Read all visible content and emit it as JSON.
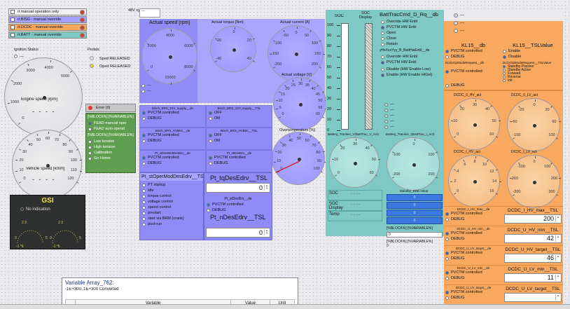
{
  "override": {
    "items": [
      {
        "label": "rt manual operation only",
        "color": "#f2f2f2"
      },
      {
        "label": "rt.BISG - manual override",
        "color": "#a6a0ff"
      },
      {
        "label": "rt.DCDC - manual override",
        "color": "#f8a85f"
      },
      {
        "label": "rt.BATT - manual override",
        "color": "#7fc9c4"
      }
    ]
  },
  "system_status_label": "48V system status",
  "system_status_value": "---",
  "ignition": {
    "title": "Ignition Status",
    "value": "---"
  },
  "pedals": {
    "title": "Pedals",
    "items": [
      "Sped RELEASED",
      "Oped RELEASED"
    ]
  },
  "engine_speed": {
    "label": "Engine speed [rpm]",
    "ticks": [
      "0",
      "1000",
      "2000",
      "3000",
      "4000",
      "5000"
    ],
    "readout": "- - - -"
  },
  "vehicle_speed": {
    "label": "Vehicle speed [km/h]",
    "ticks": [
      "0",
      "10",
      "20",
      "30",
      "40",
      "50",
      "60",
      "70",
      "80",
      "90",
      "100",
      "110",
      "120"
    ],
    "readout": "- - - -"
  },
  "error_panel": {
    "error": "Error (0)",
    "vars1": "[%BLOCK%] [%VARIABLE%]",
    "items1": [
      "FEAD manual oper",
      "FEAD auto operat"
    ],
    "vars2": "[%BLOCK%] [%VARIABLE%]",
    "items2": [
      "Low tension",
      "High tension",
      "Calibration",
      "Go Home"
    ]
  },
  "gsi": {
    "title": "GSI",
    "status": "No indication",
    "ticks": [
      "0",
      "1",
      "2",
      "3",
      "4",
      "5",
      "6",
      "7"
    ]
  },
  "actual_speed": {
    "label": "Actual speed [rpm]",
    "ticks": [
      "2000",
      "4000",
      "6000",
      "8000",
      "10000",
      "0"
    ]
  },
  "actual_torque": {
    "label": "Actual torque [Nm]",
    "ticks": [
      "-40",
      "-20",
      "0",
      "20",
      "40"
    ]
  },
  "actual_current": {
    "label": "Actual current [A]",
    "ticks": [
      "-200",
      "-150",
      "-100",
      "-50",
      "0",
      "50",
      "100",
      "150",
      "200"
    ]
  },
  "actual_voltage": {
    "label": "Actual voltage [V]",
    "ticks": [
      "0",
      "5",
      "10",
      "15",
      "20",
      "25",
      "30",
      "35",
      "40",
      "45",
      "50",
      "55",
      "60"
    ]
  },
  "overtemp": {
    "label": "Overtemperature [%]",
    "ticks": [
      "0",
      "10",
      "20",
      "30",
      "40",
      "50",
      "60",
      "70",
      "80",
      "90",
      "100"
    ]
  },
  "bisg_sel": [
    {
      "hdr": "Bisch_BRS_12V_supply__de",
      "opts": [
        "PVCTM controlled",
        "DEBUG"
      ],
      "sel": 0
    },
    {
      "hdr": "Bisch_BRS_HVBtrc__de",
      "opts": [
        "PVCTM controlled",
        "DEBUG"
      ],
      "sel": 0
    },
    {
      "hdr": "Pt_stDesMotDesBrn__de",
      "opts": [
        "PVCTM controlled",
        "DEBUG"
      ],
      "sel": 0
    }
  ],
  "bisg_sel_r": [
    {
      "hdr": "Bisch_BRS_12V_supply__TSL",
      "opts": [
        "OFF",
        "ON"
      ],
      "sel": 0
    },
    {
      "hdr": "Bisch_BRS_HVBtrc__TSL",
      "opts": [
        "OFF",
        "ON"
      ],
      "sel": 0
    },
    {
      "hdr": "Pt_stDesBrn__de",
      "opts": [
        "PVCTM controlled",
        "DEBUG"
      ],
      "sel": 0
    }
  ],
  "mot_mode": {
    "title": "Pt_stOperModDesEdrv__TSL",
    "opts": [
      "PT startup",
      "idle",
      "torque control",
      "voltage control",
      "speed control",
      "prestart",
      "start via BRM (crank)",
      "post-run"
    ]
  },
  "tq_des": {
    "title": "Pt_tqDesEdrv__TSL",
    "value": "0"
  },
  "pt_stdes": {
    "hdr": "Pt_stDesBrn__de",
    "opts": [
      "PVCTM controlled",
      "DEBUG"
    ]
  },
  "n_des": {
    "title": "Pt_nDesEdrv__TSL",
    "value": "0"
  },
  "soc": {
    "h1": "SOC",
    "h2": "SOC Display",
    "ticks": [
      "100",
      "90",
      "80",
      "70",
      "60",
      "50",
      "40",
      "30",
      "20",
      "10",
      "0"
    ]
  },
  "batt_cmd": {
    "title": "BattTracCmd_D_Rq__db",
    "opts": [
      "Override HW Enbl",
      "PVCTM HW Enbl",
      "Open",
      "Close",
      "Retain"
    ],
    "sel": 1,
    "title2": "yHxXxxYyy_B_BattHwEnbl__de",
    "opts2": [
      "Override HW Enbl",
      "PVCTM HW Enbl"
    ],
    "sel2": 1,
    "opts3": [
      "Disable (HW Enable Low)",
      "Enable (HW Enable HIGH)"
    ],
    "sel3": 1
  },
  "leds": [
    "---",
    "---",
    "---",
    "---",
    "---"
  ],
  "batt_g1": {
    "label": "Battery_Traction_V(BattTrac_V_Act)",
    "ticks": [
      "0",
      "10",
      "20",
      "30",
      "40",
      "50",
      "60"
    ]
  },
  "batt_g2": {
    "label": "Battery_Traction_I(BattTrac_I_Act)",
    "ticks": [
      "-200",
      "-100",
      "0",
      "100",
      "200"
    ]
  },
  "soc_tbl": [
    {
      "k": "SOC",
      "v": "- - - -"
    },
    {
      "k": "SOC Display",
      "v": "- - - -"
    },
    {
      "k": "Temp",
      "v": "- - - -"
    }
  ],
  "stat_bar": {
    "title": "Standby_BDB Value",
    "bars": [
      "0",
      "0",
      "0",
      "0"
    ],
    "vars": "[%BLOCK%] [%VARIABLE%]",
    "v": "0",
    "vars2": "[%BLOCK%] [%VARIABLE%]",
    "v2": "0"
  },
  "top_leds": [
    "---",
    "---",
    "---"
  ],
  "kl15": {
    "l": "KL15__db",
    "r": "KL15__TSLValue",
    "lopts": [
      "PVCTM controlled",
      "DEBUG"
    ],
    "ropts": [
      "Enable",
      "Disable"
    ]
  },
  "dcdc_mode": {
    "l": "DcDcOpModeRequest__db",
    "r": "DcDcOpModeRequest__TSLValue",
    "lopts": [
      "PVCTM controlled",
      "DEBUG"
    ],
    "ropts": [
      "Standby Passive",
      "Standby Active",
      "Forward",
      "Reverse",
      "Init"
    ]
  },
  "dcdc_g": [
    {
      "label": "DCDC_0_HV_act",
      "ticks": [
        "0",
        "10",
        "20",
        "30",
        "40",
        "50",
        "60"
      ]
    },
    {
      "label": "DCDC_0_LV_act",
      "ticks": [
        "-100",
        "-60",
        "-20",
        "0",
        "20",
        "60",
        "100"
      ]
    },
    {
      "label": "DCDC_I_HV_act",
      "ticks": [
        "0",
        "2",
        "4",
        "6",
        "8",
        "10",
        "12",
        "14",
        "16"
      ]
    },
    {
      "label": "DCDC_I_LV_act",
      "ticks": [
        "-300",
        "-200",
        "-100",
        "0",
        "100",
        "200",
        "300"
      ]
    }
  ],
  "dcdc_sets": [
    {
      "hdr": "DCDC_I_HV_max__de",
      "title": "DCDC_I_HV_max__TSL",
      "value": "200"
    },
    {
      "hdr": "DCDC_U_HV_min__de",
      "title": "DCDC_U_HV_min__TSL",
      "value": "42"
    },
    {
      "hdr": "DCDC_U_LV_target__de",
      "title": "DCDC_U_HV_target__TSL",
      "value": "46"
    },
    {
      "hdr": "DCDC_U_LV_min__de",
      "title": "DCDC_U_LV_min__TSL",
      "value": "11"
    },
    {
      "hdr": "DCDC_U_LV_target__de",
      "title": "DCDC_U_LV_target__TSL",
      "value": ""
    }
  ],
  "dcdc_opts": [
    "PVCTM controlled",
    "DEBUG"
  ],
  "var_array": {
    "title": "Variable Array_762:",
    "range": "-1E+300..1E+300 Converted",
    "cols": [
      "Variable",
      "Value",
      "Unit"
    ]
  },
  "colors": {
    "purple": "#8f8cf7",
    "teal": "#7fc9c4",
    "orange": "#f8a85f",
    "green": "#5f9e4f",
    "bar": "#3b78e0"
  }
}
